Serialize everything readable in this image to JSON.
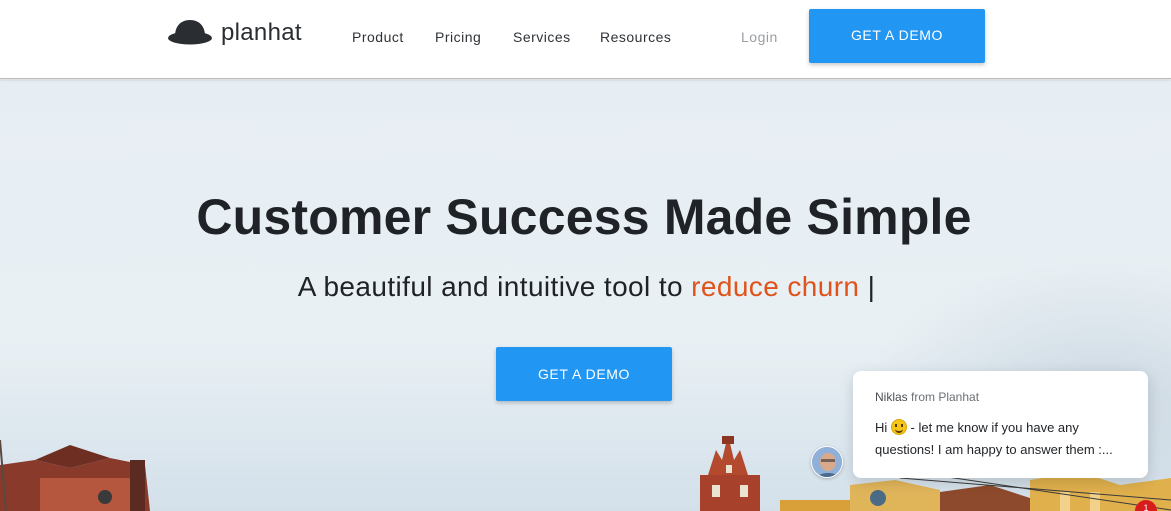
{
  "brand": {
    "name": "planhat",
    "icon": "hat-icon",
    "accent_color": "#2196f3"
  },
  "nav": {
    "links": [
      "Product",
      "Pricing",
      "Services",
      "Resources"
    ],
    "login_label": "Login",
    "cta_label": "GET A DEMO"
  },
  "hero": {
    "title": "Customer Success Made Simple",
    "subtitle_prefix": "A beautiful and intuitive tool to ",
    "subtitle_highlight": "reduce churn",
    "cursor": " |",
    "highlight_color": "#e0531c",
    "cta_label": "GET A DEMO"
  },
  "chat": {
    "sender": "Niklas",
    "sender_suffix": " from Planhat",
    "greeting": "Hi",
    "emoji": "smiley-icon",
    "message": " -  let me know if you have any questions! I am happy to answer them :...",
    "badge_count": "1"
  }
}
